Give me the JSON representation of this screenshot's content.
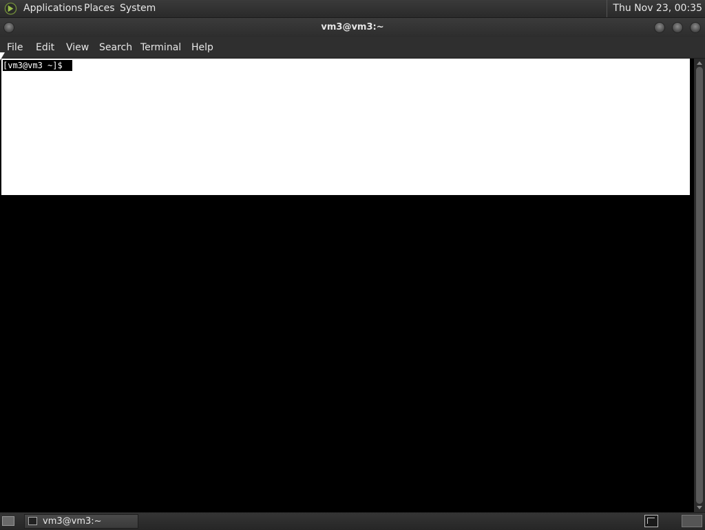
{
  "top_panel": {
    "menus": [
      "Applications",
      "Places",
      "System"
    ],
    "clock": "Thu Nov 23, 00:35",
    "distro_icon": "swirl-logo-icon"
  },
  "window": {
    "title": "vm3@vm3:~"
  },
  "menubar": {
    "items": [
      "File",
      "Edit",
      "View",
      "Search",
      "Terminal",
      "Help"
    ]
  },
  "terminal": {
    "prompt": "[vm3@vm3 ~]$",
    "background_top": "#ffffff",
    "background": "#000000"
  },
  "taskbar": {
    "task_label": "vm3@vm3:~"
  },
  "colors": {
    "panel": "#2f2f2f",
    "text": "#e8e8e8"
  }
}
